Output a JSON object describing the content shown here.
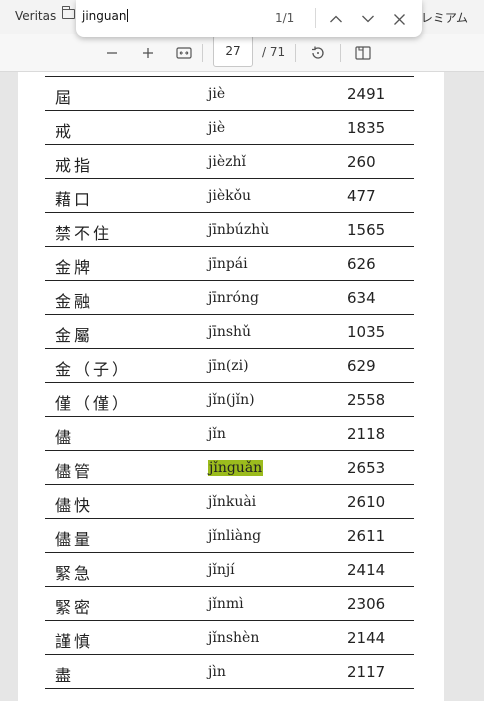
{
  "bookmarks": {
    "left_label": "Veritas",
    "right_label": "プレミアム"
  },
  "find": {
    "query": "jinguan",
    "count": "1/1"
  },
  "toolbar": {
    "page_current": "27",
    "page_total": "/ 71"
  },
  "rows": [
    {
      "kanji": "屆",
      "pinyin": "jiè",
      "num": "2491"
    },
    {
      "kanji": "戒",
      "pinyin": "jiè",
      "num": "1835"
    },
    {
      "kanji": "戒指",
      "pinyin": "jièzhǐ",
      "num": "260"
    },
    {
      "kanji": "藉口",
      "pinyin": "jièkǒu",
      "num": "477"
    },
    {
      "kanji": "禁不住",
      "pinyin": "jīnbúzhù",
      "num": "1565"
    },
    {
      "kanji": "金牌",
      "pinyin": "jīnpái",
      "num": "626"
    },
    {
      "kanji": "金融",
      "pinyin": "jīnróng",
      "num": "634"
    },
    {
      "kanji": "金屬",
      "pinyin": "jīnshǔ",
      "num": "1035"
    },
    {
      "kanji": "金（子）",
      "pinyin": "jīn(zi)",
      "num": "629"
    },
    {
      "kanji": "僅（僅）",
      "pinyin": "jǐn(jǐn)",
      "num": "2558"
    },
    {
      "kanji": "儘",
      "pinyin": "jǐn",
      "num": "2118"
    },
    {
      "kanji": "儘管",
      "pinyin": "jǐnguǎn",
      "num": "2653"
    },
    {
      "kanji": "儘快",
      "pinyin": "jǐnkuài",
      "num": "2610"
    },
    {
      "kanji": "儘量",
      "pinyin": "jǐnliàng",
      "num": "2611"
    },
    {
      "kanji": "緊急",
      "pinyin": "jǐnjí",
      "num": "2414"
    },
    {
      "kanji": "緊密",
      "pinyin": "jǐnmì",
      "num": "2306"
    },
    {
      "kanji": "謹慎",
      "pinyin": "jǐnshèn",
      "num": "2144"
    },
    {
      "kanji": "盡",
      "pinyin": "jìn",
      "num": "2117"
    }
  ],
  "highlight_color": "#9bbb1d"
}
